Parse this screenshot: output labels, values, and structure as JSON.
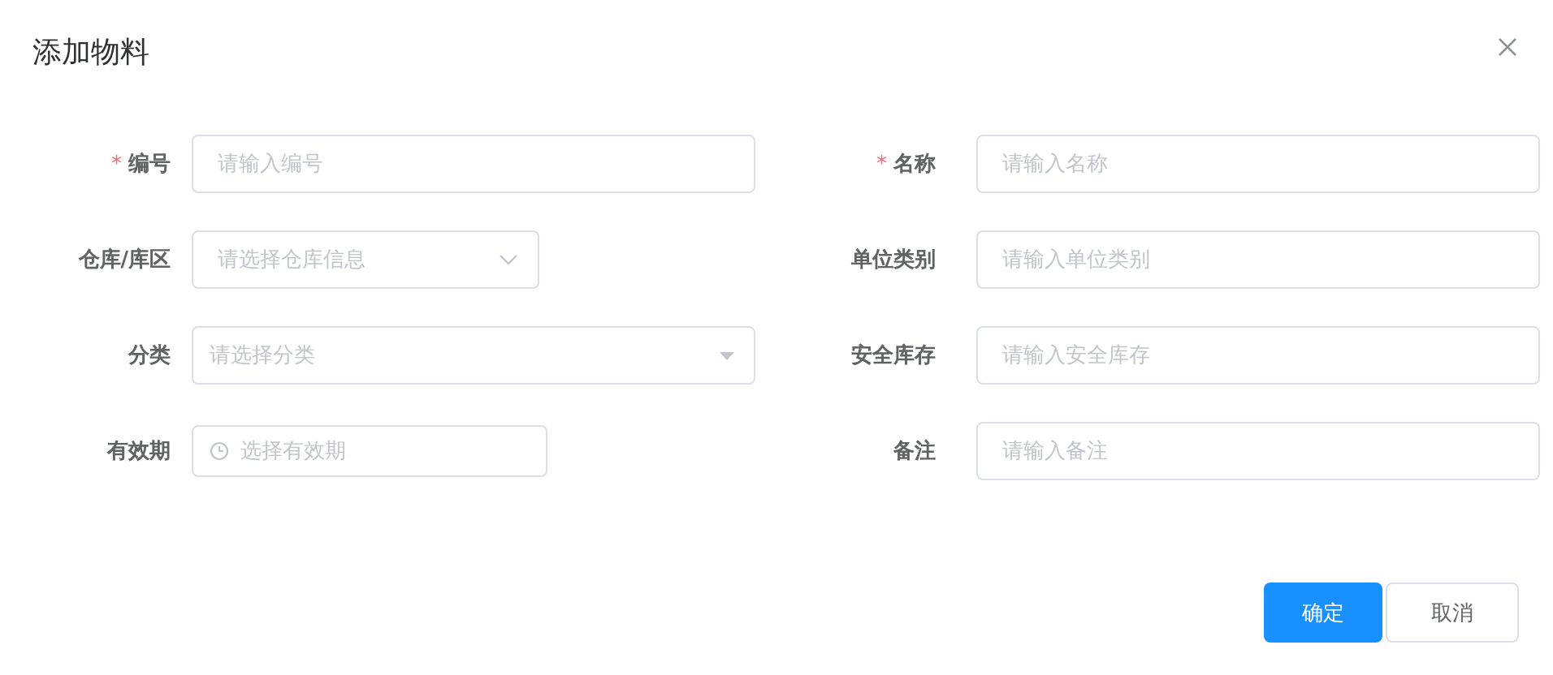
{
  "dialog": {
    "title": "添加物料"
  },
  "fields": [
    {
      "kind": "text",
      "label": "编号",
      "required_mark": "*",
      "placeholder": "请输入编号"
    },
    {
      "kind": "text",
      "label": "名称",
      "required_mark": "*",
      "placeholder": "请输入名称"
    },
    {
      "kind": "select",
      "label": "仓库/库区",
      "placeholder": "请选择仓库信息"
    },
    {
      "kind": "text",
      "label": "单位类别",
      "placeholder": "请输入单位类别"
    },
    {
      "kind": "dropdown",
      "label": "分类",
      "placeholder": "请选择分类"
    },
    {
      "kind": "text",
      "label": "安全库存",
      "placeholder": "请输入安全库存"
    },
    {
      "kind": "date",
      "label": "有效期",
      "placeholder": "选择有效期"
    },
    {
      "kind": "text",
      "label": "备注",
      "placeholder": "请输入备注"
    }
  ],
  "buttons": [
    {
      "label": "确定",
      "kind": "primary"
    },
    {
      "label": "取消",
      "kind": "default"
    }
  ]
}
